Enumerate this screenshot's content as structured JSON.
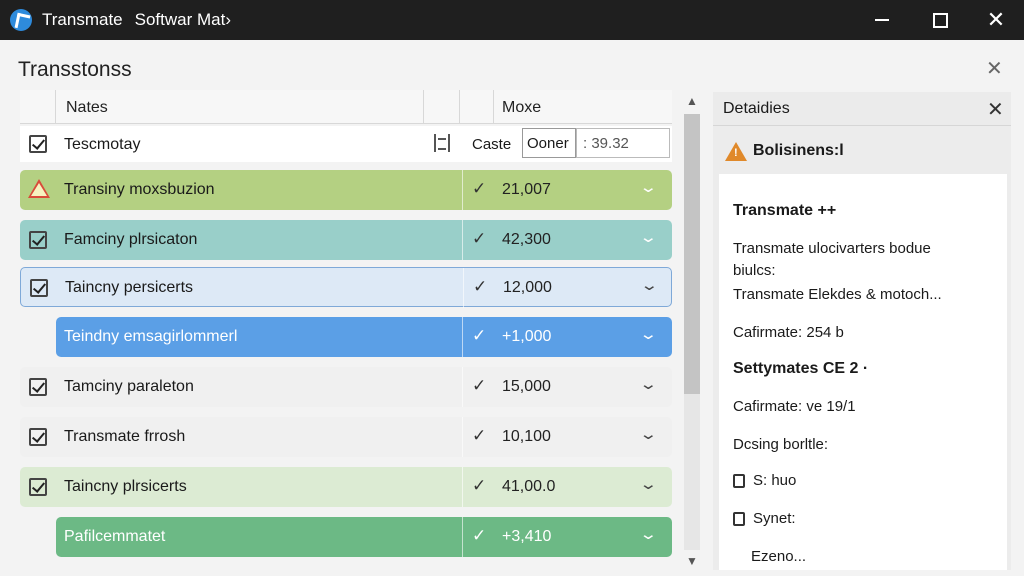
{
  "window": {
    "app_name": "Transmate",
    "subtitle": "Softwar Mat",
    "subtitle_chevron": "›",
    "accent": "#2e8bdc"
  },
  "dialog": {
    "title": "Transstonss",
    "close_glyph": "✕"
  },
  "grid": {
    "headers": {
      "name": "Nates",
      "value": "Moxe"
    },
    "first_row": {
      "label": "Tescmotay",
      "caste_label": "Caste",
      "owner_label": "Ooner",
      "number_value": "39.32"
    },
    "rows": [
      {
        "label": "Transiny moxsbuzion",
        "value": "21,007",
        "color": "#b4d082",
        "warning": true
      },
      {
        "label": "Famciny plrsicaton",
        "value": "42,300",
        "color": "#99cfc9"
      },
      {
        "label": "Taincny persicerts",
        "value": "12,000",
        "color": "#dde9f6",
        "selected": true
      },
      {
        "label": "Teindny emsagirlommerl",
        "value": "+1,000",
        "color": "#5b9fe6",
        "highlight": true
      },
      {
        "label": "Tamciny paraleton",
        "value": "15,000",
        "color": "#f0f0f0"
      },
      {
        "label": "Transmate frrosh",
        "value": "10,100",
        "color": "#f0f0f0"
      },
      {
        "label": "Taincny plrsicerts",
        "value": "41,00.0",
        "color": "#dcebd3"
      },
      {
        "label": "Pafilcemmatet",
        "value": "+3,410",
        "color": "#6cb985",
        "highlight": true
      }
    ],
    "tick_glyph": "✓",
    "chevron_glyph": "⌄"
  },
  "details": {
    "title": "Detaidies",
    "close_glyph": "✕",
    "warning_text": "Bolisinens:l",
    "items": [
      {
        "text": "Transmate ++",
        "bold": true
      },
      {
        "text": "Transmate ulocivarters bodue"
      },
      {
        "text": "biulcs:"
      },
      {
        "text": "Transmate Elekdes & motoch..."
      },
      {
        "text": "Cafirmate: 254 b"
      },
      {
        "text": "Settymates CE 2 ·",
        "bold": true
      },
      {
        "text": "Cafirmate: ve 19/1"
      },
      {
        "text": "Dcsing borltle:"
      },
      {
        "text": "S: huo",
        "checkbox": true
      },
      {
        "text": "Synet:",
        "checkbox": true
      },
      {
        "text": "Ezeno..."
      }
    ]
  }
}
